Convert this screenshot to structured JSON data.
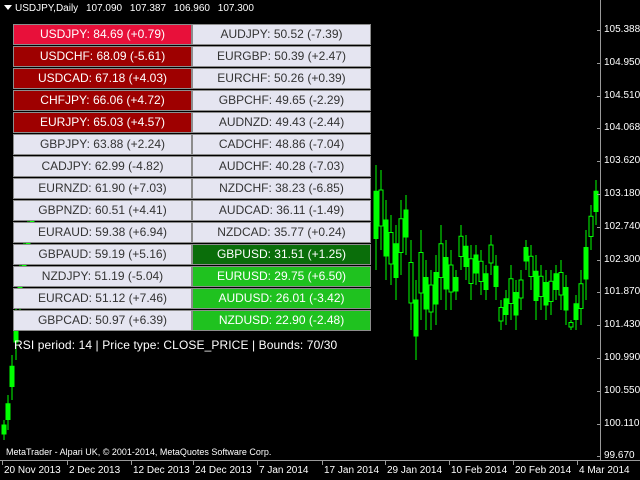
{
  "header": {
    "symbol": "USDJPY,Daily",
    "open": "107.090",
    "high": "107.387",
    "low": "106.960",
    "close": "107.300"
  },
  "price_axis": [
    "105.388",
    "104.950",
    "104.510",
    "104.068",
    "103.620",
    "103.180",
    "102.740",
    "102.300",
    "101.870",
    "101.430",
    "100.990",
    "100.550",
    "100.110",
    "99.670"
  ],
  "time_axis": [
    "20 Nov 2013",
    "2 Dec 2013",
    "12 Dec 2013",
    "24 Dec 2013",
    "7 Jan 2014",
    "17 Jan 2014",
    "29 Jan 2014",
    "10 Feb 2014",
    "20 Feb 2014",
    "4 Mar 2014"
  ],
  "colors": {
    "candle": "#00ff00",
    "red": "#e8103a",
    "dark_red": "#9e0000",
    "neutral": "#e5e5f1",
    "dark_green": "#0a6e0a",
    "green": "#1fc21f"
  },
  "rsi_table": {
    "left": [
      {
        "text": "USDJPY: 84.69 (+0.79)",
        "style": "red"
      },
      {
        "text": "USDCHF: 68.09 (-5.61)",
        "style": "dark_red"
      },
      {
        "text": "USDCAD: 67.18 (+4.03)",
        "style": "dark_red"
      },
      {
        "text": "CHFJPY: 66.06 (+4.72)",
        "style": "dark_red"
      },
      {
        "text": "EURJPY: 65.03 (+4.57)",
        "style": "dark_red"
      },
      {
        "text": "GBPJPY: 63.88 (+2.24)",
        "style": "neutral"
      },
      {
        "text": "CADJPY: 62.99 (-4.82)",
        "style": "neutral"
      },
      {
        "text": "EURNZD: 61.90 (+7.03)",
        "style": "neutral"
      },
      {
        "text": "GBPNZD: 60.51 (+4.41)",
        "style": "neutral"
      },
      {
        "text": "EURAUD: 59.38 (+6.94)",
        "style": "neutral"
      },
      {
        "text": "GBPAUD: 59.19 (+5.16)",
        "style": "neutral"
      },
      {
        "text": "NZDJPY: 51.19 (-5.04)",
        "style": "neutral"
      },
      {
        "text": "EURCAD: 51.12 (+7.46)",
        "style": "neutral"
      },
      {
        "text": "GBPCAD: 50.97 (+6.39)",
        "style": "neutral"
      }
    ],
    "right": [
      {
        "text": "AUDJPY: 50.52 (-7.39)",
        "style": "neutral"
      },
      {
        "text": "EURGBP: 50.39 (+2.47)",
        "style": "neutral"
      },
      {
        "text": "EURCHF: 50.26 (+0.39)",
        "style": "neutral"
      },
      {
        "text": "GBPCHF: 49.65 (-2.29)",
        "style": "neutral"
      },
      {
        "text": "AUDNZD: 49.43 (-2.44)",
        "style": "neutral"
      },
      {
        "text": "CADCHF: 48.86 (-7.04)",
        "style": "neutral"
      },
      {
        "text": "AUDCHF: 40.28 (-7.03)",
        "style": "neutral"
      },
      {
        "text": "NZDCHF: 38.23 (-6.85)",
        "style": "neutral"
      },
      {
        "text": "AUDCAD: 36.11 (-1.49)",
        "style": "neutral"
      },
      {
        "text": "NZDCAD: 35.77 (+0.24)",
        "style": "neutral"
      },
      {
        "text": "GBPUSD: 31.51 (+1.25)",
        "style": "dark_green"
      },
      {
        "text": "EURUSD: 29.75 (+6.50)",
        "style": "green"
      },
      {
        "text": "AUDUSD: 26.01 (-3.42)",
        "style": "green"
      },
      {
        "text": "NZDUSD: 22.90 (-2.48)",
        "style": "green"
      }
    ]
  },
  "rsi_info": "RSI period: 14 | Price type: CLOSE_PRICE | Bounds: 70/30",
  "copyright": "MetaTrader - Alpari UK, © 2001-2014, MetaQuotes Software Corp."
}
